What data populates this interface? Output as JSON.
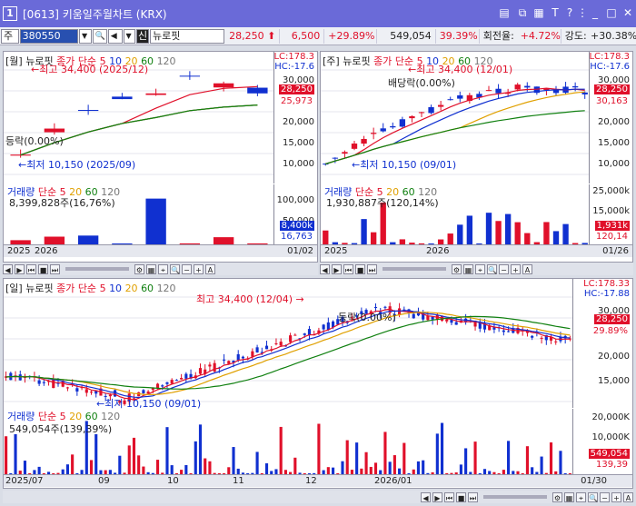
{
  "window": {
    "number": "1",
    "title": "[0613] 키움일주월차트 (KRX)"
  },
  "toolbar": {
    "market": "주",
    "code": "380550",
    "stock_badge": "신",
    "stock_name": "뉴로핏",
    "price": "28,250",
    "change": "6,500",
    "change_pct": "+29.89%",
    "volume": "549,054",
    "volume_ratio": "39.39%",
    "turnover_label": "회전율:",
    "turnover": "+4.72%",
    "strength_label": "강도:",
    "strength": "+30.38%"
  },
  "panels": {
    "monthly": {
      "title": "[월] 뉴로핏",
      "ma": [
        "종가",
        "단순",
        "5",
        "10",
        "20",
        "60",
        "120"
      ],
      "high": "최고 34,400 (2025/12)",
      "low": "최저 10,150 (2025/09)",
      "drop": "등락(0.00%)",
      "lc": "LC:178.3",
      "hc": "HC:-17.6",
      "yticks": [
        "30,000",
        "25,000",
        "20,000",
        "15,000",
        "10,000"
      ],
      "price_tag": "28,250",
      "ma_tag": "25,973",
      "vol_title": "거래량",
      "vol_ma": [
        "단순",
        "5",
        "20",
        "60",
        "120"
      ],
      "vol_value": "8,399,828주(16,76%)",
      "vol_ticks": [
        "100,000",
        "50,000"
      ],
      "vol_tag": "8,400k",
      "vol_tag2": "16,763",
      "x": [
        "2025",
        "2026"
      ],
      "x_right": "01/02"
    },
    "weekly": {
      "title": "[주] 뉴로핏",
      "ma": [
        "종가",
        "단순",
        "5",
        "10",
        "20",
        "60",
        "120"
      ],
      "high": "최고 34,400 (12/01)",
      "low": "최저 10,150 (09/01)",
      "drop": "배당락(0.00%)",
      "lc": "LC:178.3",
      "hc": "HC:-17.6",
      "yticks": [
        "30,000",
        "25,000",
        "20,000",
        "15,000",
        "10,000"
      ],
      "price_tag": "28,250",
      "ma_tag": "30,163",
      "vol_title": "거래량",
      "vol_ma": [
        "단순",
        "5",
        "20",
        "60",
        "120"
      ],
      "vol_value": "1,930,887주(120,14%)",
      "vol_ticks": [
        "25,000k",
        "15,000k",
        "5,000k"
      ],
      "vol_tag": "1,931k",
      "vol_tag2": "120,14",
      "x": [
        "2025",
        "2026"
      ],
      "x_right": "01/26"
    },
    "daily": {
      "title": "[일] 뉴로핏",
      "ma": [
        "종가",
        "단순",
        "5",
        "10",
        "20",
        "60",
        "120"
      ],
      "high": "최고 34,400 (12/04)",
      "low": "최저 10,150 (09/01)",
      "drop": "등락(0.00%)",
      "lc": "LC:178.33",
      "hc": "HC:-17.88",
      "yticks": [
        "30,000",
        "25,000",
        "20,000",
        "15,000"
      ],
      "price_tag": "28,250",
      "pct_tag": "29.89%",
      "vol_title": "거래량",
      "vol_ma": [
        "단순",
        "5",
        "20",
        "60",
        "120"
      ],
      "vol_value": "549,054주(139,39%)",
      "vol_ticks": [
        "20,000K",
        "10,000K"
      ],
      "vol_tag": "549,054",
      "vol_tag2": "139,39",
      "x": [
        "2025/07",
        "09",
        "10",
        "11",
        "12",
        "2026/01"
      ],
      "x_right": "01/30"
    }
  },
  "colors": {
    "up": "#e0102a",
    "down": "#1030d0",
    "ma5": "#e0102a",
    "ma10": "#1030d0",
    "ma20": "#e0a000",
    "ma60": "#108010",
    "ma120": "#777777"
  }
}
